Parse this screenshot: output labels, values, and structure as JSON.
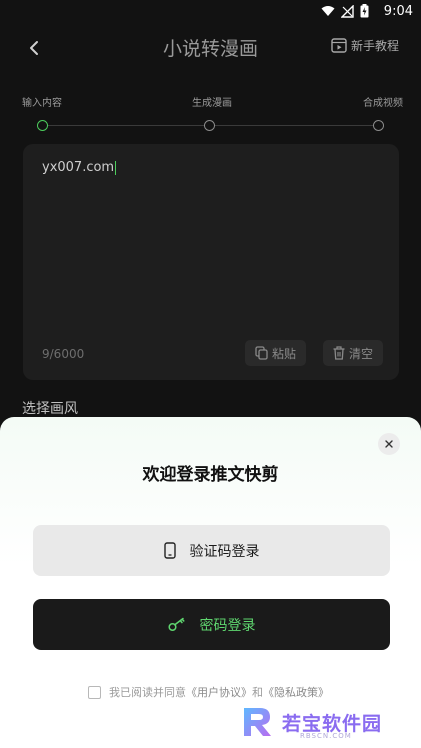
{
  "status_bar": {
    "time": "9:04"
  },
  "header": {
    "title": "小说转漫画",
    "tutorial_label": "新手教程"
  },
  "steps": [
    {
      "label": "输入内容",
      "active": true
    },
    {
      "label": "生成漫画",
      "active": false
    },
    {
      "label": "合成视频",
      "active": false
    }
  ],
  "editor": {
    "text": "yx007.com",
    "counter": "9/6000",
    "paste_label": "粘贴",
    "clear_label": "清空"
  },
  "style_section": {
    "title": "选择画风"
  },
  "login_sheet": {
    "title": "欢迎登录推文快剪",
    "code_login_label": "验证码登录",
    "password_login_label": "密码登录",
    "agreement": {
      "prefix": "我已阅读并同意",
      "user_agreement": "《用户协议》",
      "and": "和",
      "privacy_policy": "《隐私政策》",
      "checked": false
    }
  },
  "watermark": {
    "text": "若宝软件园",
    "subtext": "RBSCN.COM"
  },
  "colors": {
    "accent": "#4ccc5c",
    "background": "#121212",
    "sheet": "#ffffff",
    "watermark": "#8a6cf0"
  }
}
